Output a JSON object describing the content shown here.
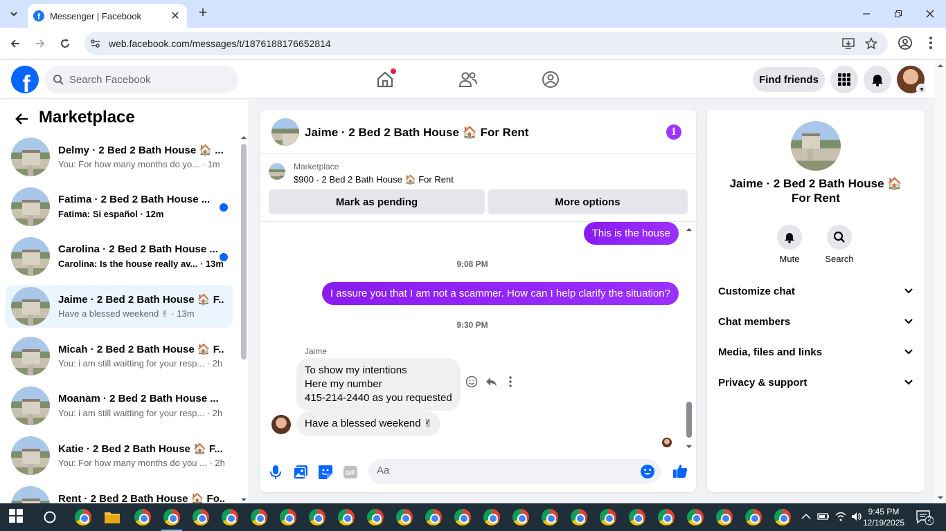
{
  "browser": {
    "tab_title": "Messenger | Facebook",
    "url": "web.facebook.com/messages/t/1876188176652814"
  },
  "fb": {
    "search_placeholder": "Search Facebook",
    "find_friends": "Find friends",
    "brand_color": "#0866ff"
  },
  "sidebar": {
    "title": "Marketplace",
    "conversations": [
      {
        "name": "Delmy · 2 Bed 2 Bath House 🏠 ...",
        "sub": "You: For how many months do yo... · 1m",
        "unread": false,
        "active": false
      },
      {
        "name": "Fatima · 2 Bed 2 Bath House ...",
        "sub": "Fatima: Si español · 12m",
        "unread": true,
        "active": false
      },
      {
        "name": "Carolina · 2 Bed 2 Bath House ...",
        "sub": "Carolina: Is the house really av... · 13m",
        "unread": true,
        "active": false
      },
      {
        "name": "Jaime · 2 Bed 2 Bath House 🏠 F...",
        "sub": "Have a blessed weekend ✌ · 13m",
        "unread": false,
        "active": true
      },
      {
        "name": "Micah · 2 Bed 2 Bath House 🏠 F...",
        "sub": "You: i am still waitting for your resp... · 2h",
        "unread": false,
        "active": false
      },
      {
        "name": "Moanam · 2 Bed 2 Bath House ...",
        "sub": "You: i am still waitting for your resp... · 2h",
        "unread": false,
        "active": false
      },
      {
        "name": "Katie · 2 Bed 2 Bath House 🏠 F...",
        "sub": "You: For how many months do you ... · 2h",
        "unread": false,
        "active": false
      },
      {
        "name": "Rent · 2 Bed 2 Bath House 🏠 Fo...",
        "sub": "",
        "unread": false,
        "active": false
      }
    ]
  },
  "chat": {
    "title": "Jaime · 2 Bed 2 Bath House 🏠 For Rent",
    "marketplace_label": "Marketplace",
    "listing": "$900 - 2 Bed 2 Bath House 🏠 For Rent",
    "mark_pending": "Mark as pending",
    "more_options": "More options",
    "messages": {
      "out1": "This is the house",
      "ts1": "9:08 PM",
      "out2": "I assure you that I am not a scammer. How can I help clarify the situation?",
      "ts2": "9:30 PM",
      "sender": "Jaime",
      "in1_line1": "To show my intentions",
      "in1_line2": "Here my number",
      "in1_line3": "415-214-2440 as you requested",
      "in2": "Have a blessed weekend ✌"
    },
    "composer_placeholder": "Aa",
    "gif_label": "GIF"
  },
  "info": {
    "name": "Jaime · 2 Bed 2 Bath House 🏠 For Rent",
    "mute": "Mute",
    "search": "Search",
    "rows": [
      "Customize chat",
      "Chat members",
      "Media, files and links",
      "Privacy & support"
    ]
  },
  "taskbar": {
    "time": "9:45 PM",
    "date": "12/19/2025",
    "notifications": "2"
  }
}
